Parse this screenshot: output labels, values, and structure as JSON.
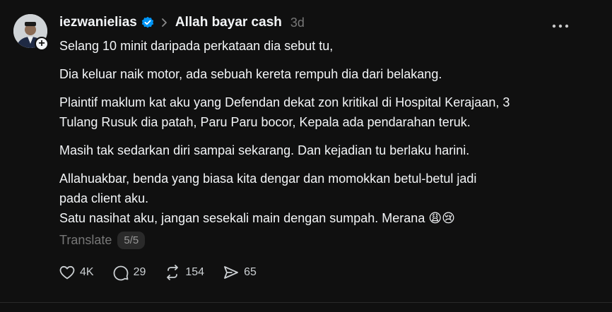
{
  "post": {
    "username": "iezwanielias",
    "topic": "Allah bayar cash",
    "time": "3d",
    "paragraphs": [
      [
        "Selang 10 minit daripada perkataan dia sebut tu,"
      ],
      [
        "Dia keluar naik motor, ada sebuah kereta rempuh dia dari belakang."
      ],
      [
        "Plaintif maklum kat aku yang Defendan dekat zon kritikal di Hospital Kerajaan, 3",
        "Tulang Rusuk dia patah, Paru Paru bocor, Kepala ada pendarahan teruk."
      ],
      [
        "Masih tak sedarkan diri sampai sekarang. Dan kejadian tu berlaku harini."
      ],
      [
        "Allahuakbar, benda yang biasa kita dengar dan momokkan betul-betul jadi",
        "pada client aku.",
        "Satu nasihat aku, jangan sesekali main dengan sumpah. Merana 😩😢"
      ]
    ],
    "translate_label": "Translate",
    "page_indicator": "5/5"
  },
  "actions": {
    "likes": "4K",
    "replies": "29",
    "reposts": "154",
    "shares": "65"
  },
  "icons": {
    "verified": "verified-badge-icon",
    "chevron": "chevron-right-icon",
    "more": "more-options-icon",
    "like": "heart-icon",
    "reply": "comment-bubble-icon",
    "repost": "repost-icon",
    "share": "send-icon",
    "follow": "plus-icon"
  },
  "colors": {
    "background": "#101010",
    "text": "#f3f5f7",
    "muted": "#777777",
    "verified": "#0095f6"
  }
}
